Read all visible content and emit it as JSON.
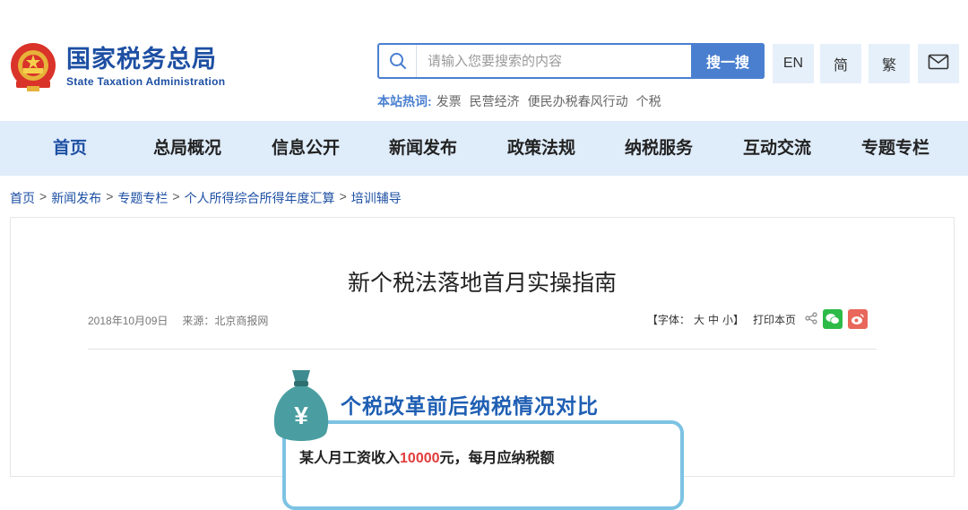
{
  "site": {
    "name_cn": "国家税务总局",
    "name_en": "State Taxation Administration"
  },
  "search": {
    "placeholder": "请输入您要搜索的内容",
    "button": "搜一搜"
  },
  "utility": {
    "en": "EN",
    "simplified": "简",
    "traditional": "繁"
  },
  "hotwords": {
    "label": "本站热词:",
    "items": [
      "发票",
      "民营经济",
      "便民办税春风行动",
      "个税"
    ]
  },
  "nav": {
    "items": [
      "首页",
      "总局概况",
      "信息公开",
      "新闻发布",
      "政策法规",
      "纳税服务",
      "互动交流",
      "专题专栏"
    ]
  },
  "breadcrumb": {
    "items": [
      "首页",
      "新闻发布",
      "专题专栏",
      "个人所得综合所得年度汇算",
      "培训辅导"
    ],
    "sep": ">"
  },
  "article": {
    "title": "新个税法落地首月实操指南",
    "date": "2018年10月09日",
    "source": "来源：北京商报网",
    "font_label": "【字体：",
    "font_large": "大",
    "font_medium": "中",
    "font_small": "小】",
    "print": "打印本页"
  },
  "infographic": {
    "title": "个税改革前后纳税情况对比",
    "line_prefix": "某人月工资收入",
    "line_amount": "10000",
    "line_suffix": "元，每月应纳税额"
  },
  "colors": {
    "brand_blue": "#1d4fa3",
    "accent_blue": "#4a7fd0",
    "nav_bg": "#dfecfa"
  }
}
